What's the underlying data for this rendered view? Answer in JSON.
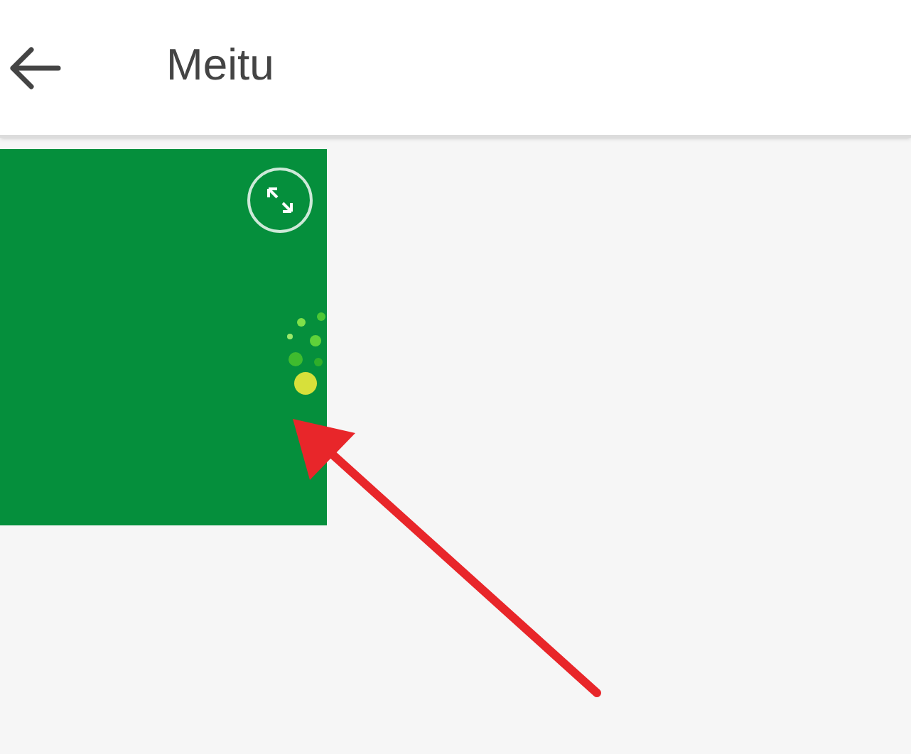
{
  "header": {
    "title": "Meitu"
  }
}
